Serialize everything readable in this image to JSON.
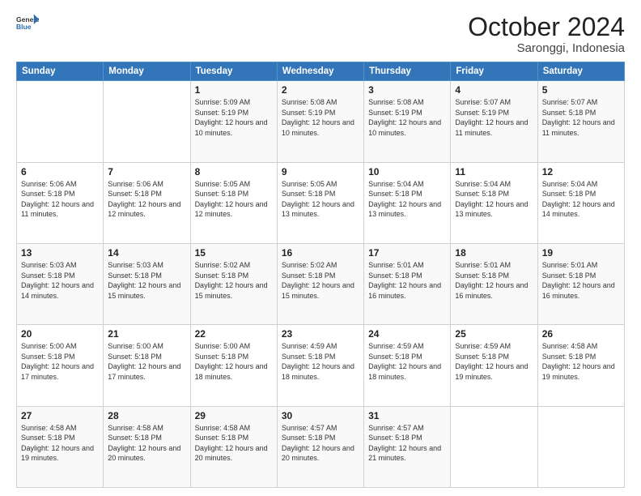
{
  "header": {
    "logo_general": "General",
    "logo_blue": "Blue",
    "title": "October 2024",
    "subtitle": "Saronggi, Indonesia"
  },
  "days_of_week": [
    "Sunday",
    "Monday",
    "Tuesday",
    "Wednesday",
    "Thursday",
    "Friday",
    "Saturday"
  ],
  "weeks": [
    [
      {
        "day": "",
        "info": ""
      },
      {
        "day": "",
        "info": ""
      },
      {
        "day": "1",
        "info": "Sunrise: 5:09 AM\nSunset: 5:19 PM\nDaylight: 12 hours and 10 minutes."
      },
      {
        "day": "2",
        "info": "Sunrise: 5:08 AM\nSunset: 5:19 PM\nDaylight: 12 hours and 10 minutes."
      },
      {
        "day": "3",
        "info": "Sunrise: 5:08 AM\nSunset: 5:19 PM\nDaylight: 12 hours and 10 minutes."
      },
      {
        "day": "4",
        "info": "Sunrise: 5:07 AM\nSunset: 5:19 PM\nDaylight: 12 hours and 11 minutes."
      },
      {
        "day": "5",
        "info": "Sunrise: 5:07 AM\nSunset: 5:18 PM\nDaylight: 12 hours and 11 minutes."
      }
    ],
    [
      {
        "day": "6",
        "info": "Sunrise: 5:06 AM\nSunset: 5:18 PM\nDaylight: 12 hours and 11 minutes."
      },
      {
        "day": "7",
        "info": "Sunrise: 5:06 AM\nSunset: 5:18 PM\nDaylight: 12 hours and 12 minutes."
      },
      {
        "day": "8",
        "info": "Sunrise: 5:05 AM\nSunset: 5:18 PM\nDaylight: 12 hours and 12 minutes."
      },
      {
        "day": "9",
        "info": "Sunrise: 5:05 AM\nSunset: 5:18 PM\nDaylight: 12 hours and 13 minutes."
      },
      {
        "day": "10",
        "info": "Sunrise: 5:04 AM\nSunset: 5:18 PM\nDaylight: 12 hours and 13 minutes."
      },
      {
        "day": "11",
        "info": "Sunrise: 5:04 AM\nSunset: 5:18 PM\nDaylight: 12 hours and 13 minutes."
      },
      {
        "day": "12",
        "info": "Sunrise: 5:04 AM\nSunset: 5:18 PM\nDaylight: 12 hours and 14 minutes."
      }
    ],
    [
      {
        "day": "13",
        "info": "Sunrise: 5:03 AM\nSunset: 5:18 PM\nDaylight: 12 hours and 14 minutes."
      },
      {
        "day": "14",
        "info": "Sunrise: 5:03 AM\nSunset: 5:18 PM\nDaylight: 12 hours and 15 minutes."
      },
      {
        "day": "15",
        "info": "Sunrise: 5:02 AM\nSunset: 5:18 PM\nDaylight: 12 hours and 15 minutes."
      },
      {
        "day": "16",
        "info": "Sunrise: 5:02 AM\nSunset: 5:18 PM\nDaylight: 12 hours and 15 minutes."
      },
      {
        "day": "17",
        "info": "Sunrise: 5:01 AM\nSunset: 5:18 PM\nDaylight: 12 hours and 16 minutes."
      },
      {
        "day": "18",
        "info": "Sunrise: 5:01 AM\nSunset: 5:18 PM\nDaylight: 12 hours and 16 minutes."
      },
      {
        "day": "19",
        "info": "Sunrise: 5:01 AM\nSunset: 5:18 PM\nDaylight: 12 hours and 16 minutes."
      }
    ],
    [
      {
        "day": "20",
        "info": "Sunrise: 5:00 AM\nSunset: 5:18 PM\nDaylight: 12 hours and 17 minutes."
      },
      {
        "day": "21",
        "info": "Sunrise: 5:00 AM\nSunset: 5:18 PM\nDaylight: 12 hours and 17 minutes."
      },
      {
        "day": "22",
        "info": "Sunrise: 5:00 AM\nSunset: 5:18 PM\nDaylight: 12 hours and 18 minutes."
      },
      {
        "day": "23",
        "info": "Sunrise: 4:59 AM\nSunset: 5:18 PM\nDaylight: 12 hours and 18 minutes."
      },
      {
        "day": "24",
        "info": "Sunrise: 4:59 AM\nSunset: 5:18 PM\nDaylight: 12 hours and 18 minutes."
      },
      {
        "day": "25",
        "info": "Sunrise: 4:59 AM\nSunset: 5:18 PM\nDaylight: 12 hours and 19 minutes."
      },
      {
        "day": "26",
        "info": "Sunrise: 4:58 AM\nSunset: 5:18 PM\nDaylight: 12 hours and 19 minutes."
      }
    ],
    [
      {
        "day": "27",
        "info": "Sunrise: 4:58 AM\nSunset: 5:18 PM\nDaylight: 12 hours and 19 minutes."
      },
      {
        "day": "28",
        "info": "Sunrise: 4:58 AM\nSunset: 5:18 PM\nDaylight: 12 hours and 20 minutes."
      },
      {
        "day": "29",
        "info": "Sunrise: 4:58 AM\nSunset: 5:18 PM\nDaylight: 12 hours and 20 minutes."
      },
      {
        "day": "30",
        "info": "Sunrise: 4:57 AM\nSunset: 5:18 PM\nDaylight: 12 hours and 20 minutes."
      },
      {
        "day": "31",
        "info": "Sunrise: 4:57 AM\nSunset: 5:18 PM\nDaylight: 12 hours and 21 minutes."
      },
      {
        "day": "",
        "info": ""
      },
      {
        "day": "",
        "info": ""
      }
    ]
  ]
}
